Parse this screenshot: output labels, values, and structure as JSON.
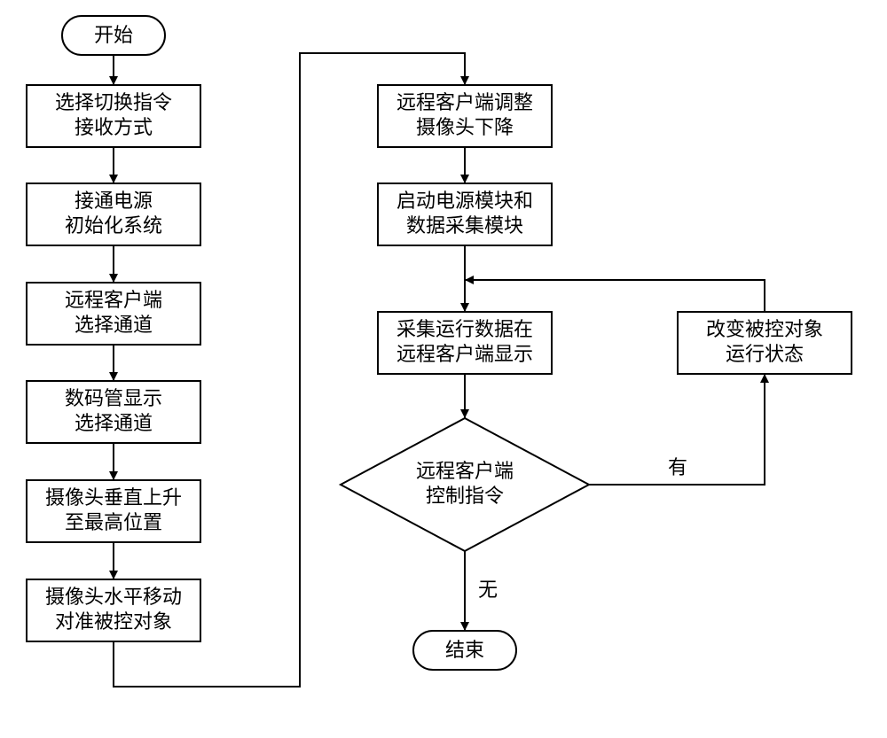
{
  "nodes": {
    "start": "开始",
    "n1_l1": "选择切换指令",
    "n1_l2": "接收方式",
    "n2_l1": "接通电源",
    "n2_l2": "初始化系统",
    "n3_l1": "远程客户端",
    "n3_l2": "选择通道",
    "n4_l1": "数码管显示",
    "n4_l2": "选择通道",
    "n5_l1": "摄像头垂直上升",
    "n5_l2": "至最高位置",
    "n6_l1": "摄像头水平移动",
    "n6_l2": "对准被控对象",
    "n7_l1": "远程客户端调整",
    "n7_l2": "摄像头下降",
    "n8_l1": "启动电源模块和",
    "n8_l2": "数据采集模块",
    "n9_l1": "采集运行数据在",
    "n9_l2": "远程客户端显示",
    "d1_l1": "远程客户端",
    "d1_l2": "控制指令",
    "n10_l1": "改变被控对象",
    "n10_l2": "运行状态",
    "end": "结束"
  },
  "labels": {
    "yes": "有",
    "no": "无"
  }
}
